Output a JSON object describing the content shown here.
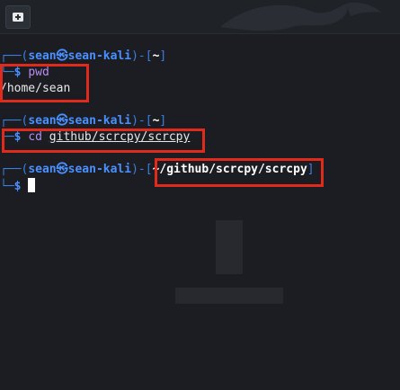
{
  "terminal": {
    "prompt": {
      "frame_top_left": "┌──(",
      "user": "sean",
      "at": "㉿",
      "host": "sean-kali",
      "mid": ")-[",
      "close": "]",
      "frame_bottom": "└─",
      "dollar": "$"
    },
    "blocks": [
      {
        "cwd": "~",
        "command": "pwd",
        "output": "/home/sean"
      },
      {
        "cwd": "~",
        "cmd_name": "cd",
        "cmd_arg": "github/scrcpy/scrcpy"
      },
      {
        "cwd": "~/github/scrcpy/scrcpy"
      }
    ]
  },
  "watermark": "KALI LINUX",
  "colors": {
    "highlight_box": "#e02a1c",
    "prompt_blue": "#3a7fe0",
    "user_blue": "#4a90ff"
  }
}
